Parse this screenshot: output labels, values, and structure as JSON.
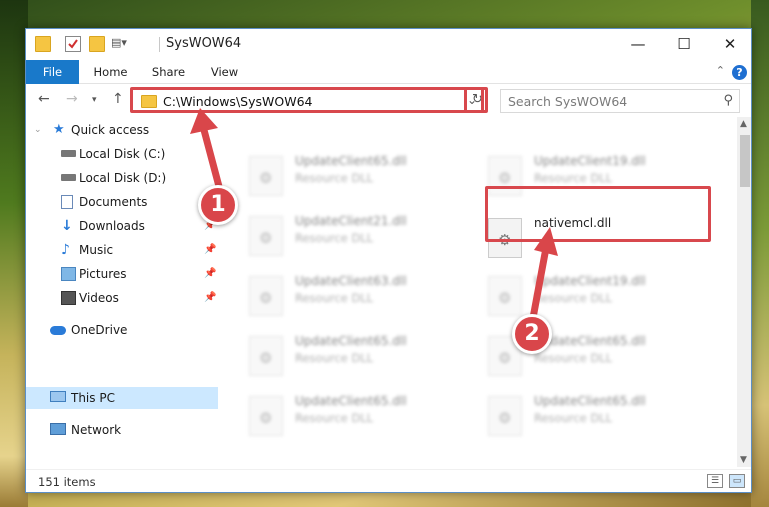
{
  "window": {
    "title": "SysWOW64",
    "controls": {
      "minimize": "—",
      "maximize": "☐",
      "close": "✕"
    }
  },
  "ribbon": {
    "tabs": [
      "File",
      "Home",
      "Share",
      "View"
    ],
    "help": "?"
  },
  "address": {
    "path": "C:\\Windows\\SysWOW64",
    "search_placeholder": "Search SysWOW64"
  },
  "sidebar": {
    "items": [
      {
        "label": "Quick access",
        "icon": "star-icon",
        "pinned": false
      },
      {
        "label": "Local Disk (C:)",
        "icon": "drive-icon",
        "pinned": true
      },
      {
        "label": "Local Disk (D:)",
        "icon": "drive-icon",
        "pinned": true
      },
      {
        "label": "Documents",
        "icon": "documents-icon",
        "pinned": true
      },
      {
        "label": "Downloads",
        "icon": "download-icon",
        "pinned": true
      },
      {
        "label": "Music",
        "icon": "music-icon",
        "pinned": true
      },
      {
        "label": "Pictures",
        "icon": "pictures-icon",
        "pinned": true
      },
      {
        "label": "Videos",
        "icon": "videos-icon",
        "pinned": true
      },
      {
        "label": "OneDrive",
        "icon": "cloud-icon",
        "pinned": false
      },
      {
        "label": "This PC",
        "icon": "computer-icon",
        "pinned": false,
        "selected": true
      },
      {
        "label": "Network",
        "icon": "network-icon",
        "pinned": false
      }
    ]
  },
  "files": {
    "left": [
      {
        "name": "UpdateClient65.dll",
        "type": "Resource DLL"
      },
      {
        "name": "UpdateClient21.dll",
        "type": "Resource DLL"
      },
      {
        "name": "UpdateClient63.dll",
        "type": "Resource DLL"
      },
      {
        "name": "UpdateClient65.dll",
        "type": "Resource DLL"
      },
      {
        "name": "UpdateClient65.dll",
        "type": "Resource DLL"
      }
    ],
    "right": [
      {
        "name": "UpdateClient19.dll",
        "type": "Resource DLL"
      },
      {
        "name": "nativemcl.dll",
        "type": ""
      },
      {
        "name": "UpdateClient19.dll",
        "type": "Resource DLL"
      },
      {
        "name": "UpdateClient65.dll",
        "type": "Resource DLL"
      },
      {
        "name": "UpdateClient65.dll",
        "type": "Resource DLL"
      }
    ]
  },
  "status": {
    "items_count": "151 items"
  },
  "markers": {
    "one": "1",
    "two": "2"
  },
  "colors": {
    "accent": "#1979ca",
    "highlight": "#d8484d",
    "selected": "#cce8ff"
  }
}
